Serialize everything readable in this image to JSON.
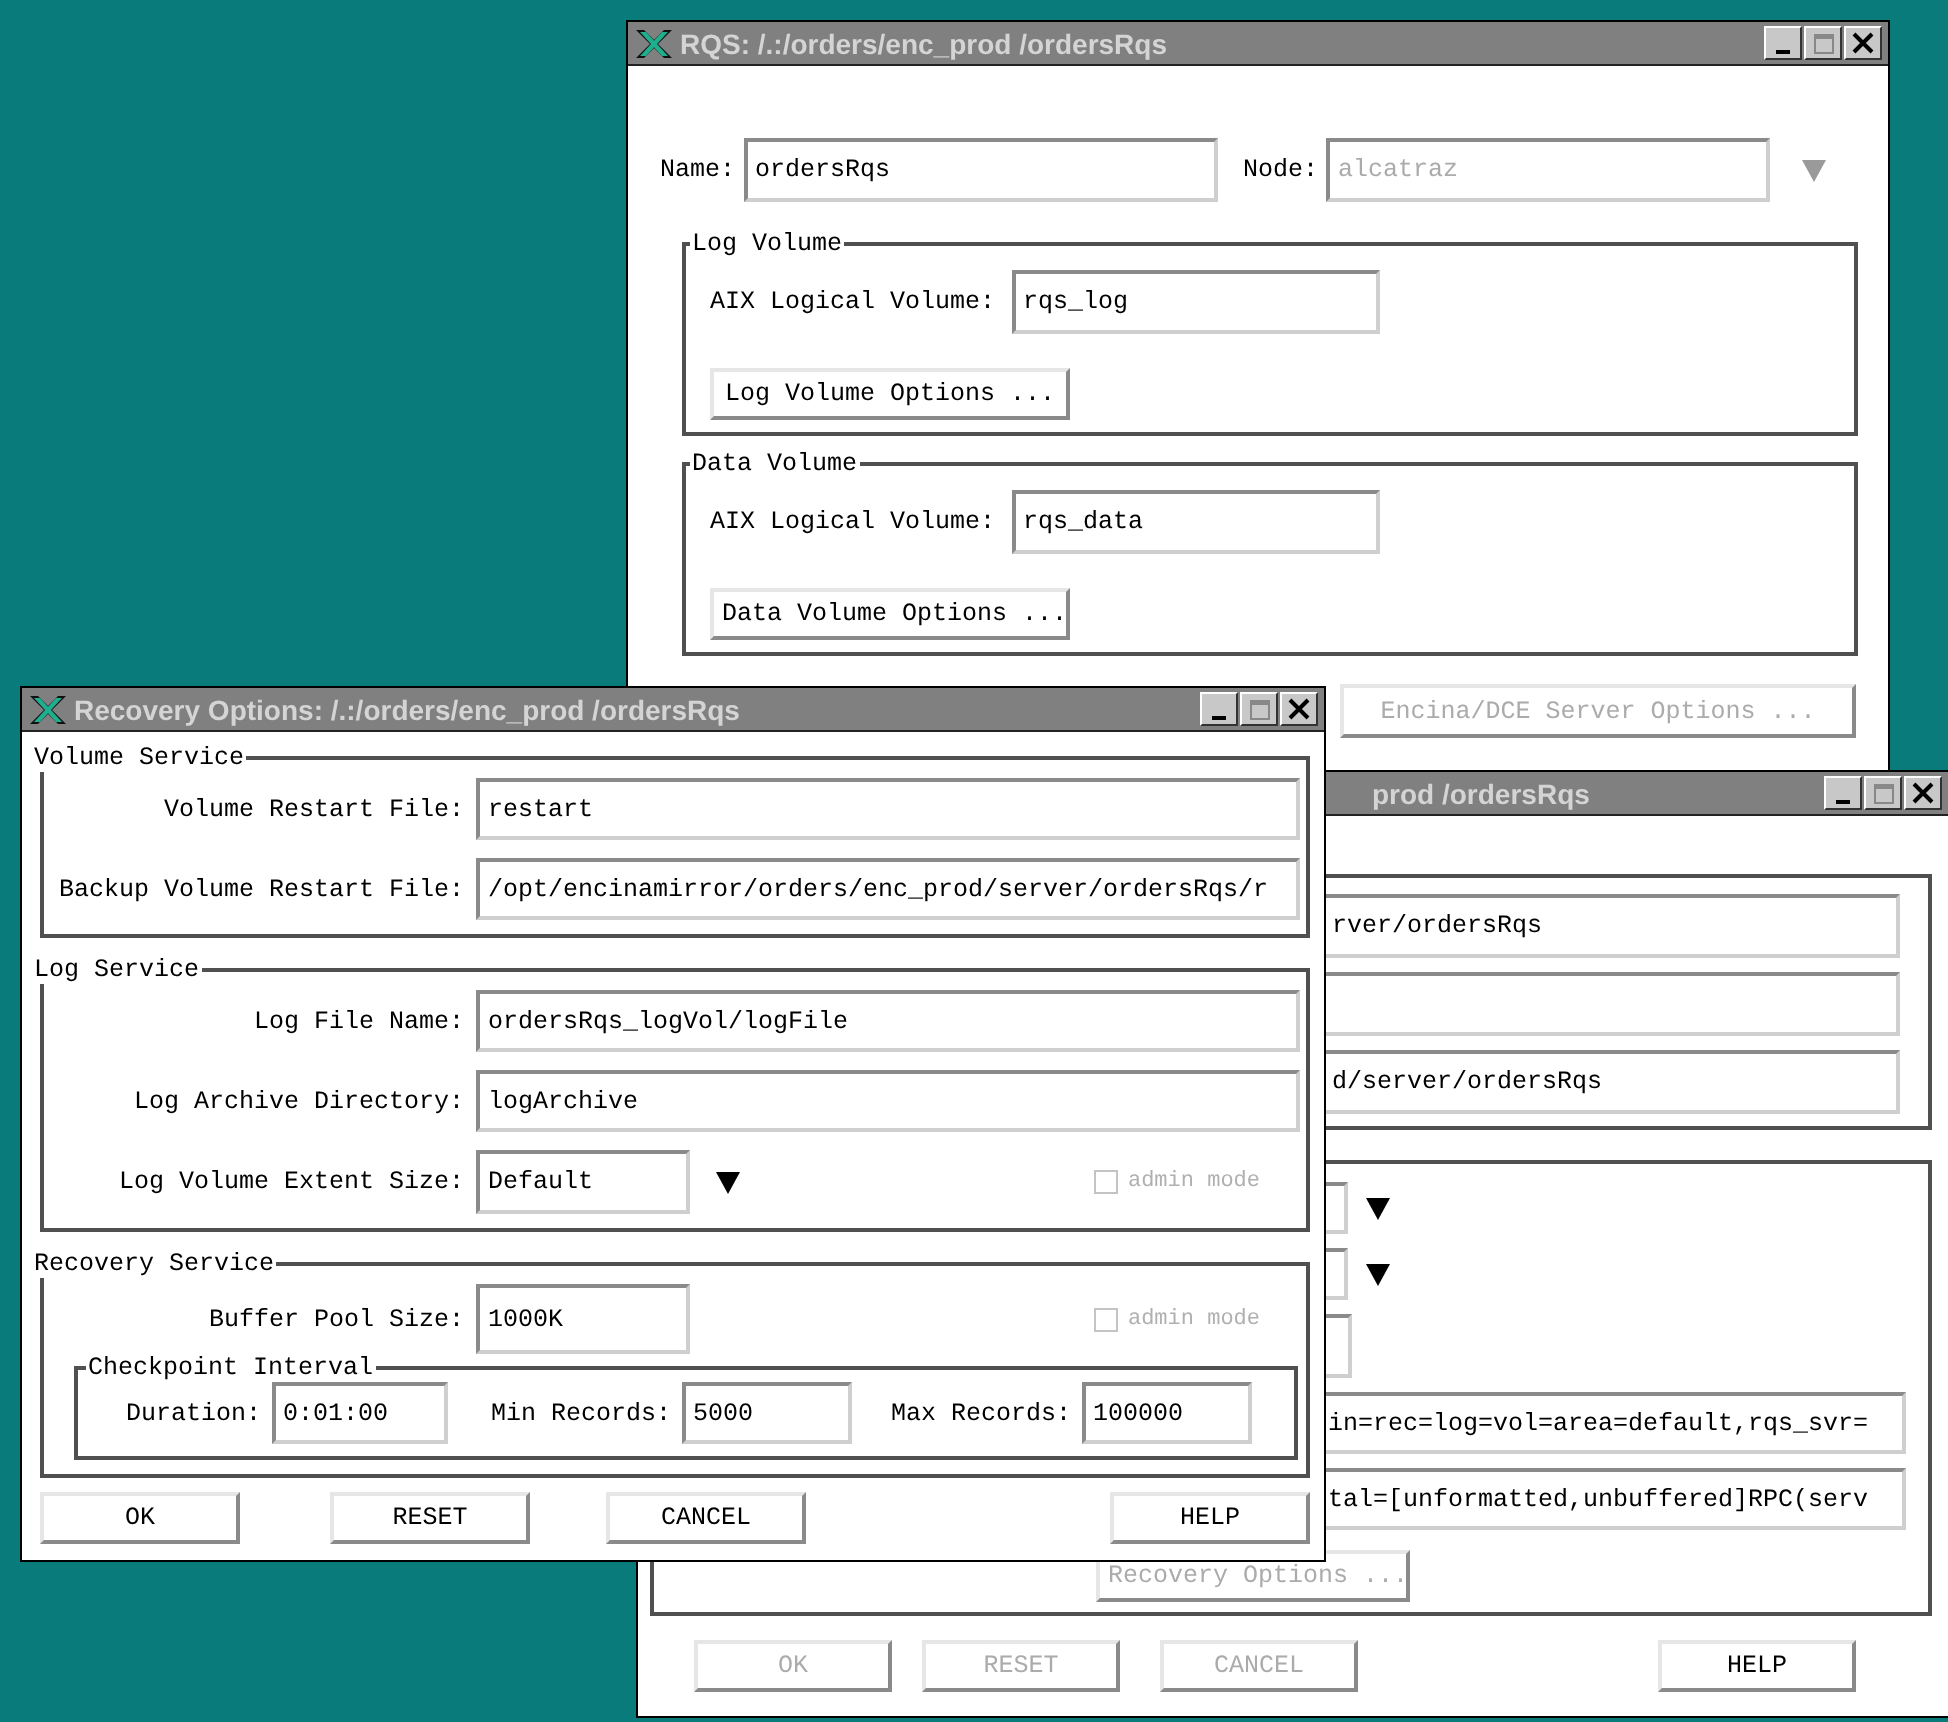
{
  "rqs_window": {
    "title": "RQS: /.:/orders/enc_prod /ordersRqs",
    "name": {
      "label": "Name:",
      "value": "ordersRqs",
      "disabled": false
    },
    "node": {
      "label": "Node:",
      "value": "alcatraz",
      "disabled": true
    },
    "volumes": [
      {
        "legend": "Log Volume",
        "label": "AIX Logical Volume:",
        "value": "rqs_log",
        "button": "Log Volume Options ..."
      },
      {
        "legend": "Data Volume",
        "label": "AIX Logical Volume:",
        "value": "rqs_data",
        "button": "Data Volume Options ..."
      }
    ],
    "server_options_button": {
      "label": "Encina/DCE Server Options ...",
      "disabled": true
    }
  },
  "recovery_window": {
    "title": "Recovery Options: /.:/orders/enc_prod /ordersRqs",
    "groups": [
      {
        "legend": "Volume Service",
        "rows": [
          {
            "kind": "text",
            "label": "Volume Restart File:",
            "value": "restart"
          },
          {
            "kind": "text",
            "label": "Backup Volume Restart File:",
            "value": "/opt/encinamirror/orders/enc_prod/server/ordersRqs/r"
          }
        ]
      },
      {
        "legend": "Log Service",
        "rows": [
          {
            "kind": "text",
            "label": "Log File Name:",
            "value": "ordersRqs_logVol/logFile"
          },
          {
            "kind": "text",
            "label": "Log Archive Directory:",
            "value": "logArchive"
          },
          {
            "kind": "dropdown",
            "label": "Log Volume Extent Size:",
            "value": "Default",
            "admin_mode": {
              "label": "admin mode",
              "checked": false,
              "disabled": true
            }
          }
        ]
      },
      {
        "legend": "Recovery Service",
        "rows": [
          {
            "kind": "short",
            "label": "Buffer Pool Size:",
            "value": "1000K",
            "admin_mode": {
              "label": "admin mode",
              "checked": false,
              "disabled": true
            }
          }
        ],
        "subgroup": {
          "legend": "Checkpoint Interval",
          "fields": [
            {
              "label": "Duration:",
              "value": "0:01:00"
            },
            {
              "label": "Min Records:",
              "value": "5000"
            },
            {
              "label": "Max Records:",
              "value": "100000"
            }
          ]
        }
      }
    ],
    "buttons": [
      {
        "label": "OK",
        "disabled": false
      },
      {
        "label": "RESET",
        "disabled": false
      },
      {
        "label": "CANCEL",
        "disabled": false
      },
      {
        "label": "HELP",
        "disabled": false
      }
    ]
  },
  "server_window": {
    "title": "prod /ordersRqs",
    "path_fields": [
      {
        "kind": "text",
        "value": "rver/ordersRqs"
      },
      {
        "kind": "text"
      },
      {
        "kind": "text",
        "value": "d/server/ordersRqs"
      }
    ],
    "option_rows": [
      {
        "kind": "dropdown"
      },
      {
        "kind": "dropdown"
      },
      {
        "kind": "short"
      },
      {
        "kind": "wide",
        "value": "in=rec=log=vol=area=default,rqs_svr="
      },
      {
        "kind": "wide",
        "value": "tal=[unformatted,unbuffered]RPC(serv"
      }
    ],
    "recovery_button": {
      "label": "Recovery Options ...",
      "disabled": true
    },
    "buttons": [
      {
        "label": "OK",
        "disabled": true
      },
      {
        "label": "RESET",
        "disabled": true
      },
      {
        "label": "CANCEL",
        "disabled": true
      },
      {
        "label": "HELP",
        "disabled": false
      }
    ]
  }
}
